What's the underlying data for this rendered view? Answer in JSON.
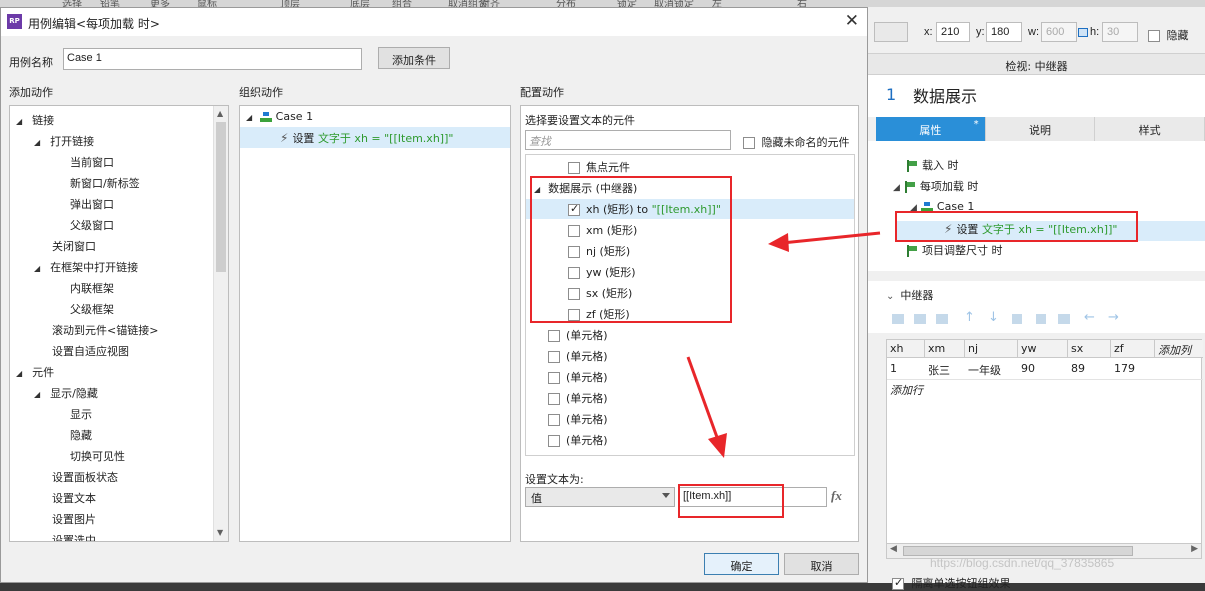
{
  "bg_topbar": {
    "items": [
      "选择",
      "铅笔",
      "更多",
      "鼠标",
      "顶层",
      "底层",
      "组合",
      "取消组合",
      "对齐",
      "分布",
      "锁定",
      "取消锁定",
      "左",
      "右"
    ]
  },
  "right_panel": {
    "x_label": "x:",
    "x_value": "210",
    "y_label": "y:",
    "y_value": "180",
    "w_label": "w:",
    "w_value": "600",
    "h_label": "h:",
    "h_value": "30",
    "hide_label": "隐藏",
    "inspect_title": "检视: 中继器",
    "widget_number": "1",
    "widget_name": "数据展示",
    "tabs": [
      "属性",
      "说明",
      "样式"
    ],
    "tab_marker": "*",
    "events": {
      "on_load": "载入 时",
      "on_item_load": "每项加载 时",
      "case": "Case 1",
      "action_prefix": "设置",
      "action_detail": "文字于 xh = \"[[Item.xh]]\"",
      "on_resize": "项目调整尺寸 时"
    },
    "section_title": "中继器",
    "table": {
      "columns": [
        "xh",
        "xm",
        "nj",
        "yw",
        "sx",
        "zf",
        "添加列"
      ],
      "rows": [
        [
          "1",
          "张三",
          "一年级",
          "90",
          "89",
          "179"
        ]
      ],
      "add_row": "添加行"
    },
    "bottom_checkbox": "隔离单选按钮组效果",
    "watermark": "https://blog.csdn.net/qq_37835865"
  },
  "dialog": {
    "title": "用例编辑<每项加载 时>",
    "case_name_label": "用例名称",
    "case_name_value": "Case 1",
    "add_condition": "添加条件",
    "col_add_action": "添加动作",
    "col_organize": "组织动作",
    "col_configure": "配置动作",
    "actions_tree": [
      {
        "label": "链接",
        "level": 0,
        "tri": "◢"
      },
      {
        "label": "打开链接",
        "level": 1,
        "tri": "◢"
      },
      {
        "label": "当前窗口",
        "level": 2
      },
      {
        "label": "新窗口/新标签",
        "level": 2
      },
      {
        "label": "弹出窗口",
        "level": 2
      },
      {
        "label": "父级窗口",
        "level": 2
      },
      {
        "label": "关闭窗口",
        "level": 1
      },
      {
        "label": "在框架中打开链接",
        "level": 1,
        "tri": "◢"
      },
      {
        "label": "内联框架",
        "level": 2
      },
      {
        "label": "父级框架",
        "level": 2
      },
      {
        "label": "滚动到元件<锚链接>",
        "level": 1
      },
      {
        "label": "设置自适应视图",
        "level": 1
      },
      {
        "label": "元件",
        "level": 0,
        "tri": "◢"
      },
      {
        "label": "显示/隐藏",
        "level": 1,
        "tri": "◢"
      },
      {
        "label": "显示",
        "level": 2
      },
      {
        "label": "隐藏",
        "level": 2
      },
      {
        "label": "切换可见性",
        "level": 2
      },
      {
        "label": "设置面板状态",
        "level": 1
      },
      {
        "label": "设置文本",
        "level": 1
      },
      {
        "label": "设置图片",
        "level": 1
      },
      {
        "label": "设置选中",
        "level": 1
      }
    ],
    "organize": {
      "case": "Case 1",
      "action_prefix": "设置",
      "action_detail": "文字于 xh = \"[[Item.xh]]\""
    },
    "configure": {
      "select_widgets_label": "选择要设置文本的元件",
      "search_placeholder": "查找",
      "hide_unnamed": "隐藏未命名的元件",
      "widgets": [
        {
          "label": "焦点元件",
          "checked": false,
          "level": 1
        },
        {
          "label": "数据展示 (中继器)",
          "checked": null,
          "level": 0
        },
        {
          "label": "xh (矩形)",
          "suffix": " to ",
          "value": "\"[[Item.xh]]\"",
          "checked": true,
          "level": 1
        },
        {
          "label": "xm (矩形)",
          "checked": false,
          "level": 1
        },
        {
          "label": "nj (矩形)",
          "checked": false,
          "level": 1
        },
        {
          "label": "yw (矩形)",
          "checked": false,
          "level": 1
        },
        {
          "label": "sx (矩形)",
          "checked": false,
          "level": 1
        },
        {
          "label": "zf (矩形)",
          "checked": false,
          "level": 1
        },
        {
          "label": "(单元格)",
          "checked": false,
          "level": 0
        },
        {
          "label": "(单元格)",
          "checked": false,
          "level": 0
        },
        {
          "label": "(单元格)",
          "checked": false,
          "level": 0
        },
        {
          "label": "(单元格)",
          "checked": false,
          "level": 0
        },
        {
          "label": "(单元格)",
          "checked": false,
          "level": 0
        },
        {
          "label": "(单元格)",
          "checked": false,
          "level": 0
        }
      ],
      "set_text_label": "设置文本为:",
      "type_value": "值",
      "text_value": "[[Item.xh]]",
      "fx": "fx"
    },
    "ok": "确定",
    "cancel": "取消"
  },
  "colors": {
    "accent": "#2a8fd8",
    "highlight": "#e8262a",
    "green_text": "#2e9a2e"
  }
}
